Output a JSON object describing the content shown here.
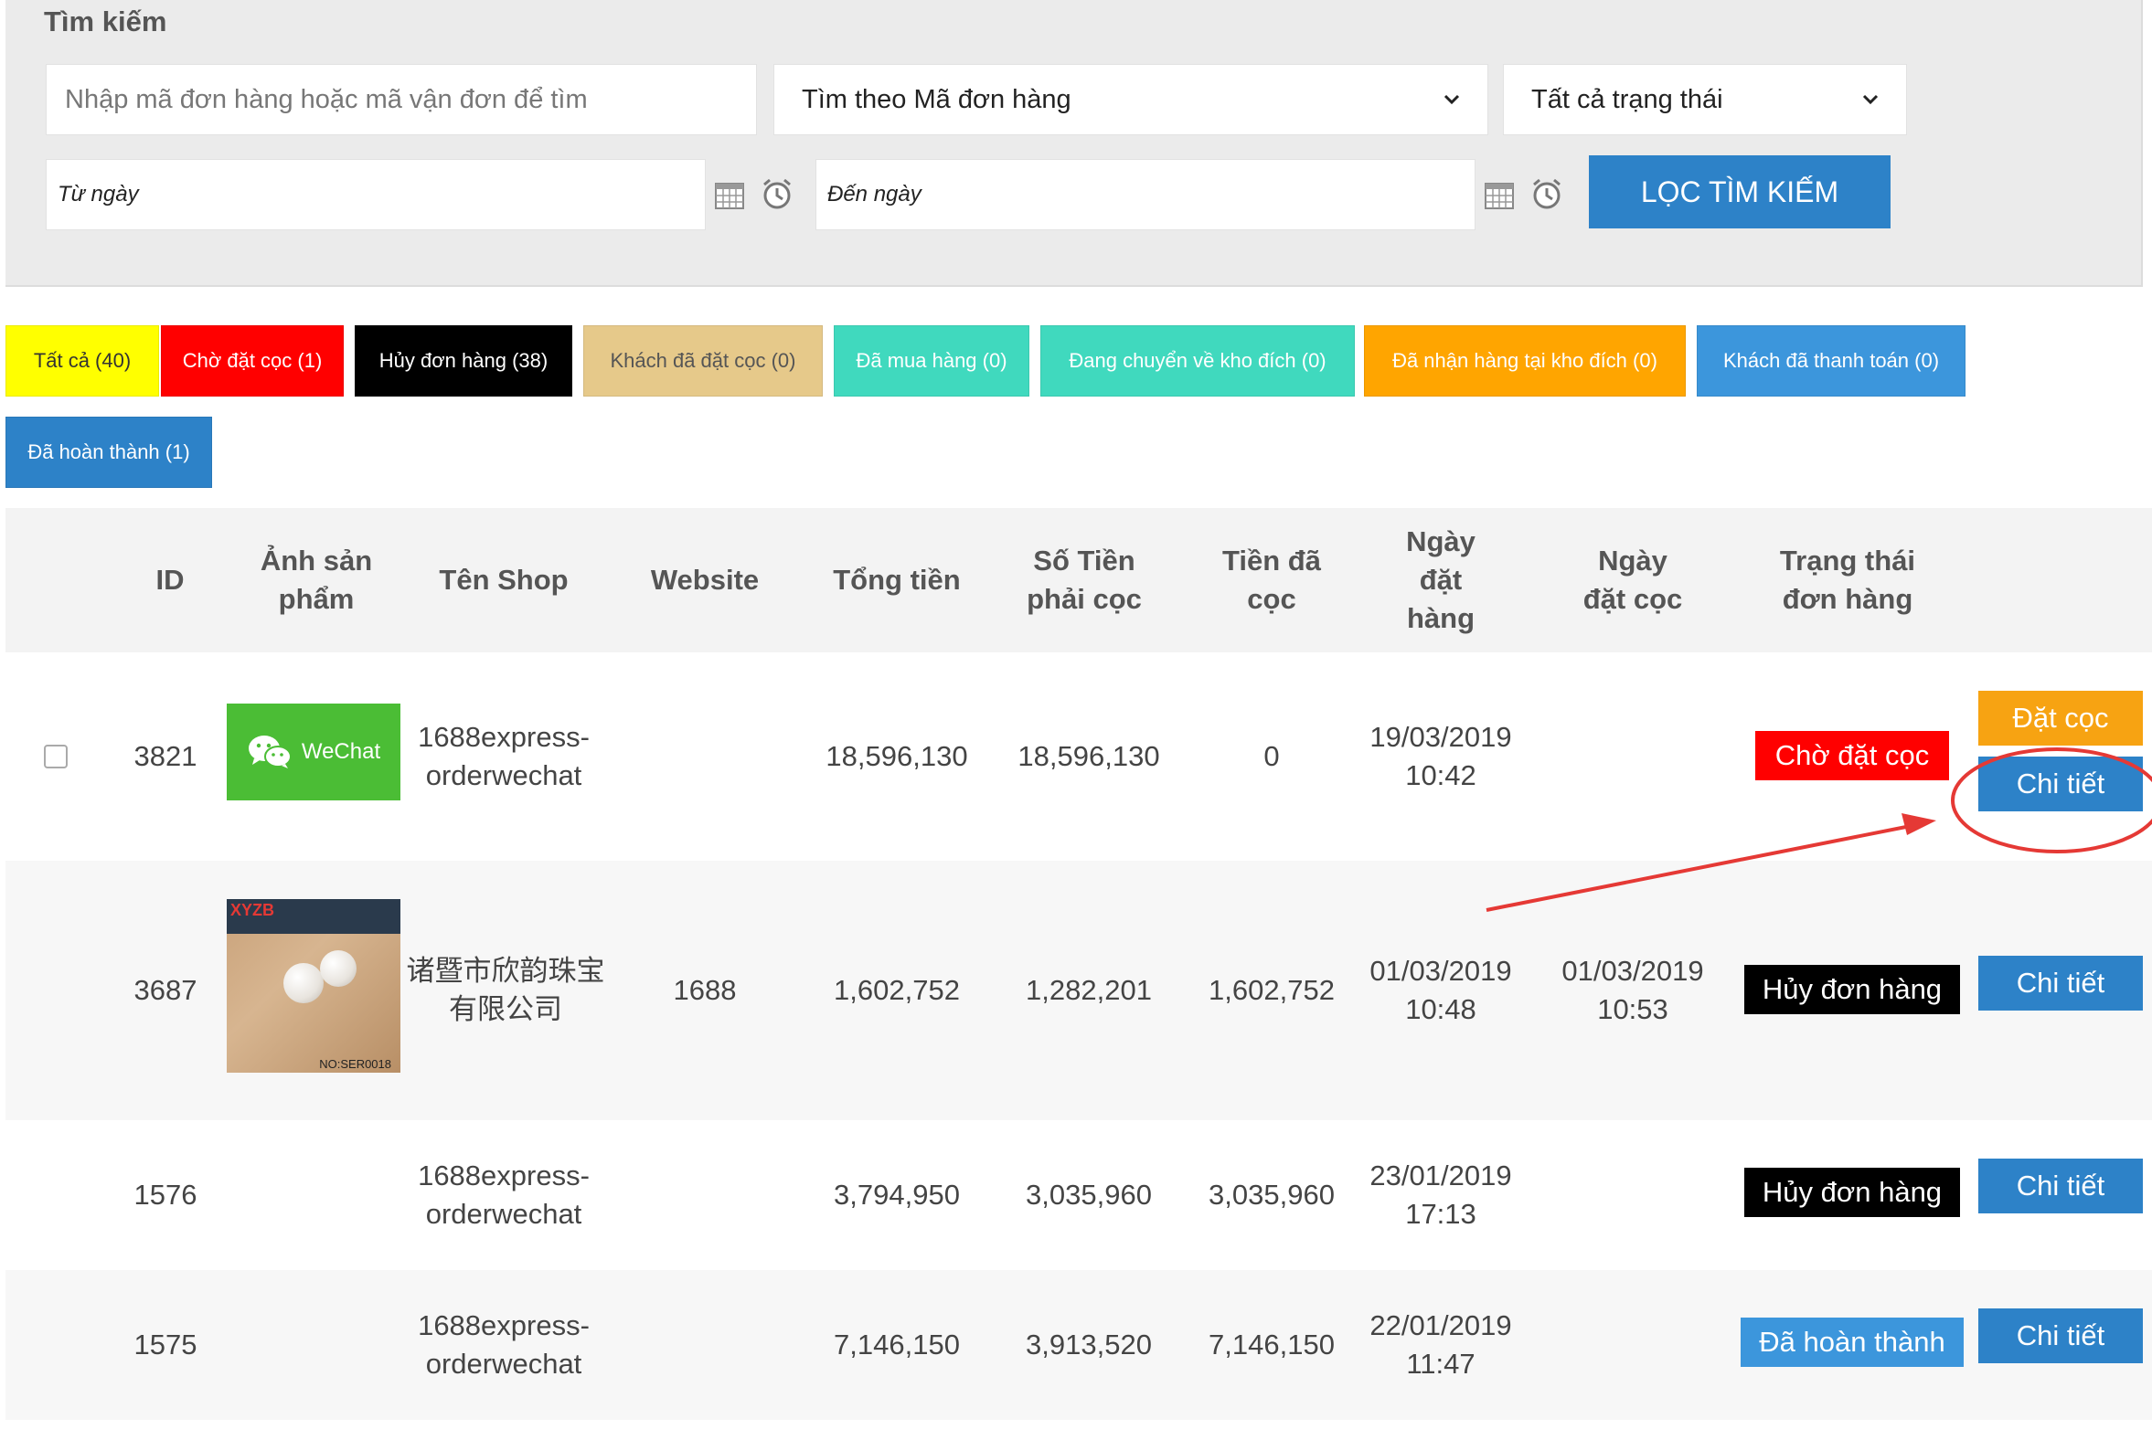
{
  "search": {
    "title": "Tìm kiếm",
    "keyword_placeholder": "Nhập mã đơn hàng hoặc mã vận đơn để tìm",
    "search_by": "Tìm theo Mã đơn hàng",
    "status_filter": "Tất cả trạng thái",
    "from_date_placeholder": "Từ ngày",
    "to_date_placeholder": "Đến ngày",
    "filter_button": "LỌC TÌM KIẾM"
  },
  "tabs": [
    {
      "label": "Tất cả (40)",
      "bg": "#ffff00",
      "fg": "#333333"
    },
    {
      "label": "Chờ đặt cọc (1)",
      "bg": "#ff0000",
      "fg": "#ffffff"
    },
    {
      "label": "Hủy đơn hàng (38)",
      "bg": "#000000",
      "fg": "#ffffff"
    },
    {
      "label": "Khách đã đặt cọc (0)",
      "bg": "#e6c98a",
      "fg": "#555555"
    },
    {
      "label": "Đã mua hàng (0)",
      "bg": "#40d9be",
      "fg": "#ffffff"
    },
    {
      "label": "Đang chuyển về kho đích (0)",
      "bg": "#40d9be",
      "fg": "#ffffff"
    },
    {
      "label": "Đã nhận hàng tại kho đích (0)",
      "bg": "#ffa500",
      "fg": "#ffffff"
    },
    {
      "label": "Khách đã thanh toán (0)",
      "bg": "#3c96dc",
      "fg": "#ffffff"
    },
    {
      "label": "Đã hoàn thành (1)",
      "bg": "#2d82c8",
      "fg": "#ffffff"
    }
  ],
  "table": {
    "headers": {
      "id": "ID",
      "image": "Ảnh sản phẩm",
      "shop": "Tên Shop",
      "website": "Website",
      "total": "Tổng tiền",
      "deposit_required": "Số Tiền phải cọc",
      "deposited": "Tiền đã cọc",
      "order_date": "Ngày đặt hàng",
      "deposit_date": "Ngày đặt cọc",
      "status": "Trạng thái đơn hàng"
    },
    "rows": [
      {
        "id": "3821",
        "image": "wechat-logo",
        "image_label": "WeChat",
        "shop": "1688express-orderwechat",
        "website": "",
        "total": "18,596,130",
        "deposit_required": "18,596,130",
        "deposited": "0",
        "order_date": "19/03/2019 10:42",
        "deposit_date": "",
        "status": "Chờ đặt cọc",
        "status_bg": "#ff0000",
        "status_fg": "#ffffff",
        "deposit_button": "Đặt cọc",
        "detail_button": "Chi tiết"
      },
      {
        "id": "3687",
        "image": "pearl-earrings-photo",
        "image_brand": "XYZB",
        "image_code": "NO:SER0018",
        "shop": "诸暨市欣韵珠宝有限公司",
        "website": "1688",
        "total": "1,602,752",
        "deposit_required": "1,282,201",
        "deposited": "1,602,752",
        "order_date": "01/03/2019 10:48",
        "deposit_date": "01/03/2019 10:53",
        "status": "Hủy đơn hàng",
        "status_bg": "#000000",
        "status_fg": "#ffffff",
        "detail_button": "Chi tiết"
      },
      {
        "id": "1576",
        "image": "",
        "shop": "1688express-orderwechat",
        "website": "",
        "total": "3,794,950",
        "deposit_required": "3,035,960",
        "deposited": "3,035,960",
        "order_date": "23/01/2019 17:13",
        "deposit_date": "",
        "status": "Hủy đơn hàng",
        "status_bg": "#000000",
        "status_fg": "#ffffff",
        "detail_button": "Chi tiết"
      },
      {
        "id": "1575",
        "image": "",
        "shop": "1688express-orderwechat",
        "website": "",
        "total": "7,146,150",
        "deposit_required": "3,913,520",
        "deposited": "7,146,150",
        "order_date": "22/01/2019 11:47",
        "deposit_date": "",
        "status": "Đã hoàn thành",
        "status_bg": "#3c96dc",
        "status_fg": "#ffffff",
        "detail_button": "Chi tiết"
      }
    ]
  },
  "annotation": {
    "color": "#e53935",
    "icon": "arrow-and-circle-highlight"
  }
}
